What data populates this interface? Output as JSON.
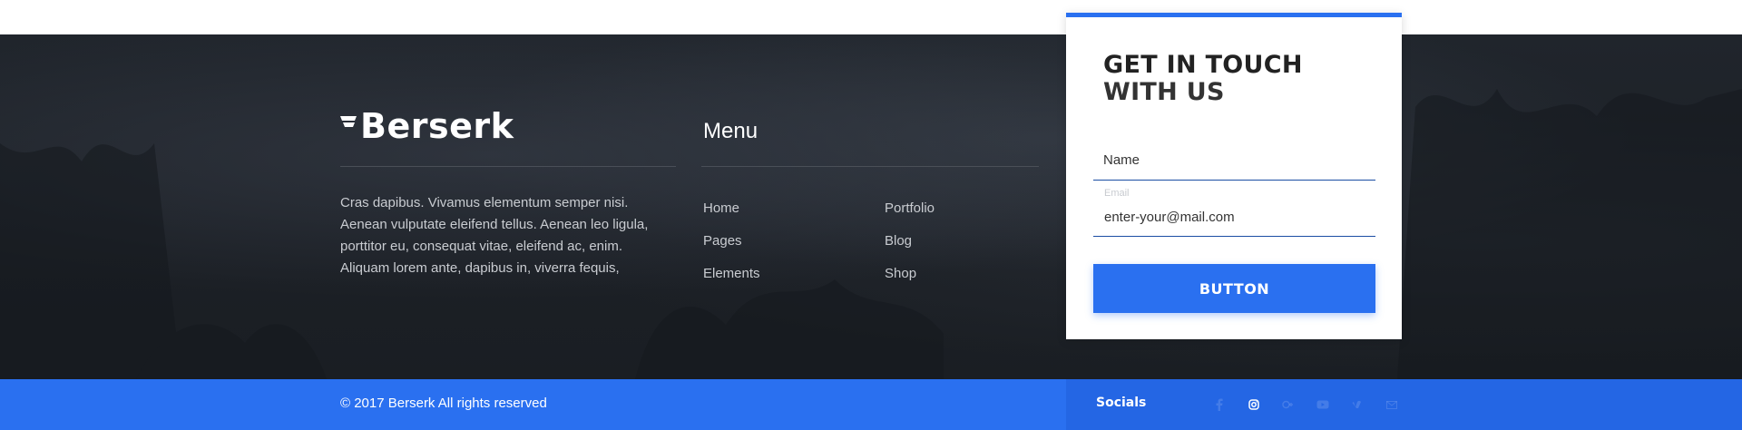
{
  "brand": {
    "name": "Berserk"
  },
  "about": {
    "text": "Cras dapibus. Vivamus elementum semper nisi. Aenean vulputate eleifend tellus. Aenean leo ligula, porttitor eu, consequat vitae, eleifend ac, enim. Aliquam lorem ante, dapibus in, viverra fequis,"
  },
  "menu": {
    "title": "Menu",
    "col1": [
      "Home",
      "Pages",
      "Elements"
    ],
    "col2": [
      "Portfolio",
      "Blog",
      "Shop"
    ]
  },
  "contact": {
    "title_line1": "GET IN TOUCH",
    "title_line2": "WITH US",
    "name_placeholder": "Name",
    "email_label": "Email",
    "email_value": "enter-your@mail.com",
    "button_label": "BUTTON"
  },
  "footer": {
    "copyright": "© 2017  Berserk  All rights reserved",
    "socials_label": "Socials",
    "social_icons": [
      "facebook-icon",
      "instagram-icon",
      "google-plus-icon",
      "youtube-icon",
      "vimeo-icon",
      "email-icon"
    ]
  },
  "colors": {
    "accent": "#2a70f0",
    "dark_bg": "#1c2026"
  }
}
